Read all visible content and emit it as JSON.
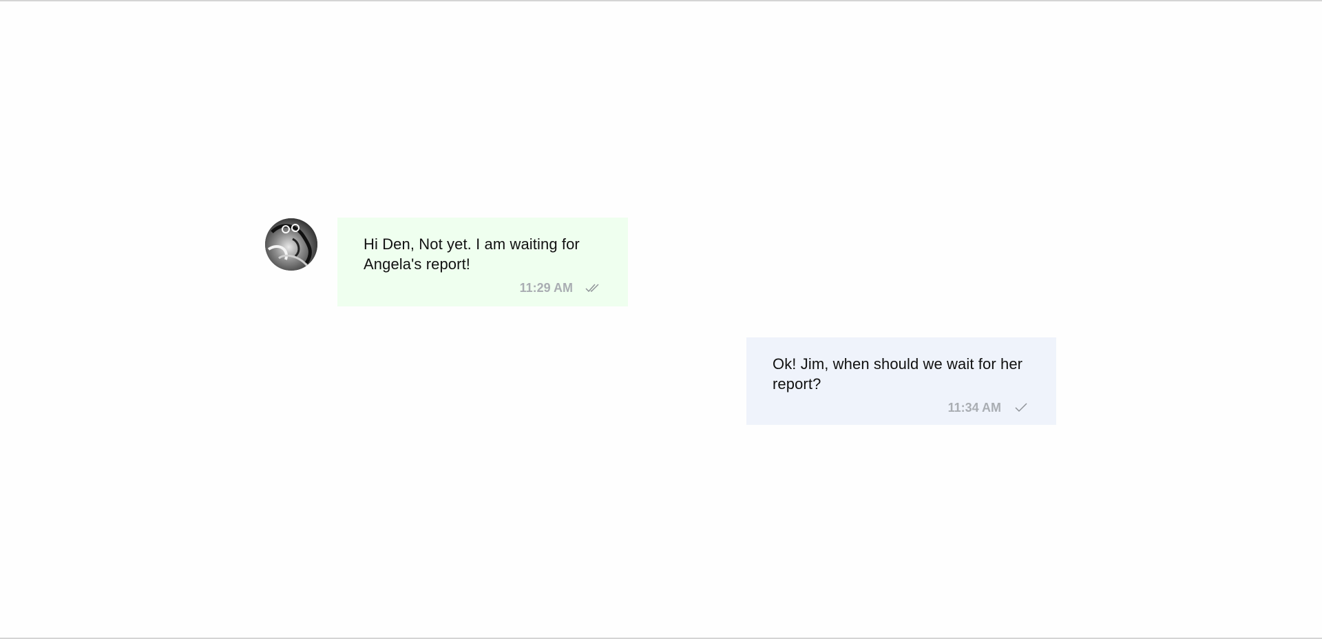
{
  "conversation": {
    "messages": [
      {
        "direction": "incoming",
        "text": "Hi Den, Not yet. I am waiting for Angela's report!",
        "time": "11:29 AM",
        "status_icon": "double-check-icon",
        "bubble_color": "#efffef"
      },
      {
        "direction": "outgoing",
        "text": "Ok! Jim, when should we wait for her report?",
        "time": "11:34 AM",
        "status_icon": "single-check-icon",
        "bubble_color": "#eff3fb"
      }
    ],
    "avatar_icon": "user-avatar-image"
  },
  "colors": {
    "timestamp": "#a9adb2",
    "text": "#111111",
    "background": "#fefefe"
  }
}
